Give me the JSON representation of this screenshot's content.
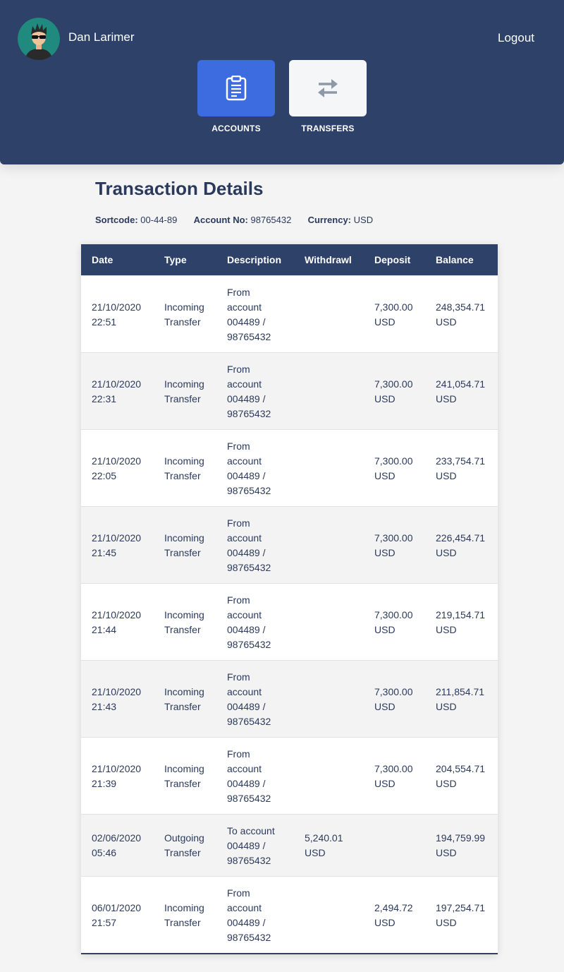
{
  "user": {
    "name": "Dan Larimer"
  },
  "header": {
    "logout_label": "Logout"
  },
  "nav": {
    "accounts_label": "ACCOUNTS",
    "transfers_label": "TRANSFERS"
  },
  "page": {
    "title": "Transaction Details",
    "sortcode_label": "Sortcode:",
    "sortcode": "00-44-89",
    "account_label": "Account No:",
    "account_no": "98765432",
    "currency_label": "Currency:",
    "currency": "USD"
  },
  "table": {
    "headers": [
      "Date",
      "Type",
      "Description",
      "Withdrawl",
      "Deposit",
      "Balance"
    ],
    "rows": [
      {
        "date": [
          "21/10/2020",
          "22:51"
        ],
        "type": [
          "Incoming",
          "Transfer"
        ],
        "desc": [
          "From",
          "account",
          "004489 /",
          "98765432"
        ],
        "withdrawl": [],
        "deposit": [
          "7,300.00",
          "USD"
        ],
        "balance": [
          "248,354.71",
          "USD"
        ]
      },
      {
        "date": [
          "21/10/2020",
          "22:31"
        ],
        "type": [
          "Incoming",
          "Transfer"
        ],
        "desc": [
          "From",
          "account",
          "004489 /",
          "98765432"
        ],
        "withdrawl": [],
        "deposit": [
          "7,300.00",
          "USD"
        ],
        "balance": [
          "241,054.71",
          "USD"
        ]
      },
      {
        "date": [
          "21/10/2020",
          "22:05"
        ],
        "type": [
          "Incoming",
          "Transfer"
        ],
        "desc": [
          "From",
          "account",
          "004489 /",
          "98765432"
        ],
        "withdrawl": [],
        "deposit": [
          "7,300.00",
          "USD"
        ],
        "balance": [
          "233,754.71",
          "USD"
        ]
      },
      {
        "date": [
          "21/10/2020",
          "21:45"
        ],
        "type": [
          "Incoming",
          "Transfer"
        ],
        "desc": [
          "From",
          "account",
          "004489 /",
          "98765432"
        ],
        "withdrawl": [],
        "deposit": [
          "7,300.00",
          "USD"
        ],
        "balance": [
          "226,454.71",
          "USD"
        ]
      },
      {
        "date": [
          "21/10/2020",
          "21:44"
        ],
        "type": [
          "Incoming",
          "Transfer"
        ],
        "desc": [
          "From",
          "account",
          "004489 /",
          "98765432"
        ],
        "withdrawl": [],
        "deposit": [
          "7,300.00",
          "USD"
        ],
        "balance": [
          "219,154.71",
          "USD"
        ]
      },
      {
        "date": [
          "21/10/2020",
          "21:43"
        ],
        "type": [
          "Incoming",
          "Transfer"
        ],
        "desc": [
          "From",
          "account",
          "004489 /",
          "98765432"
        ],
        "withdrawl": [],
        "deposit": [
          "7,300.00",
          "USD"
        ],
        "balance": [
          "211,854.71",
          "USD"
        ]
      },
      {
        "date": [
          "21/10/2020",
          "21:39"
        ],
        "type": [
          "Incoming",
          "Transfer"
        ],
        "desc": [
          "From",
          "account",
          "004489 /",
          "98765432"
        ],
        "withdrawl": [],
        "deposit": [
          "7,300.00",
          "USD"
        ],
        "balance": [
          "204,554.71",
          "USD"
        ]
      },
      {
        "date": [
          "02/06/2020",
          "05:46"
        ],
        "type": [
          "Outgoing",
          "Transfer"
        ],
        "desc": [
          "To account",
          "004489 /",
          "98765432"
        ],
        "withdrawl": [
          "5,240.01",
          "USD"
        ],
        "deposit": [],
        "balance": [
          "194,759.99",
          "USD"
        ]
      },
      {
        "date": [
          "06/01/2020",
          "21:57"
        ],
        "type": [
          "Incoming",
          "Transfer"
        ],
        "desc": [
          "From",
          "account",
          "004489 /",
          "98765432"
        ],
        "withdrawl": [],
        "deposit": [
          "2,494.72",
          "USD"
        ],
        "balance": [
          "197,254.71",
          "USD"
        ]
      }
    ]
  },
  "colors": {
    "header_bg": "#2e4169",
    "accent": "#3d6be0",
    "text": "#2b3a5c"
  }
}
